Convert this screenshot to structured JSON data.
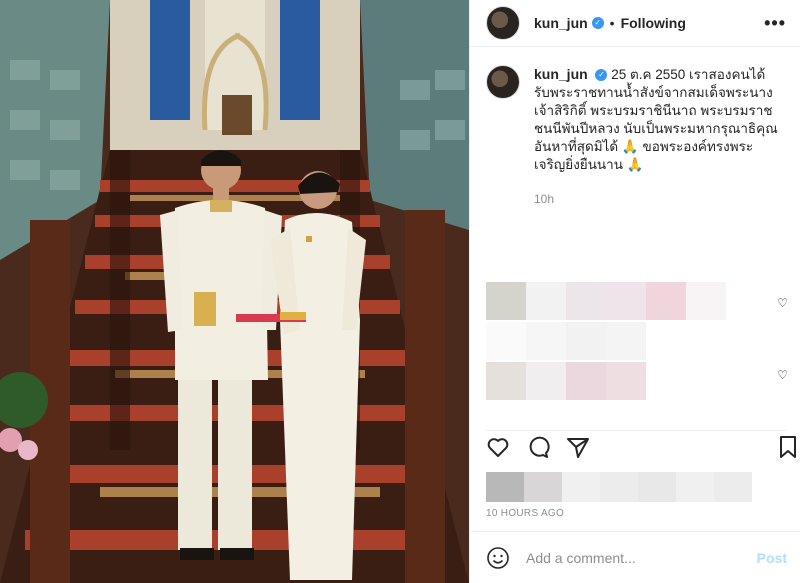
{
  "header": {
    "username": "kun_jun",
    "separator": "•",
    "follow_label": "Following",
    "more_label": "•••"
  },
  "caption": {
    "username": "kun_jun",
    "text": "25 ต.ค 2550 เราสองคนได้รับพระราชทานน้ำสังข์จากสมเด็จพระนางเจ้าสิริกิติ์ พระบรมราชินีนาถ พระบรมราชชนนีพันปีหลวง นับเป็นพระมหากรุณาธิคุณอันหาที่สุดมิได้ 🙏 ขอพระองค์ทรงพระเจริญยิ่งยืนนาน 🙏",
    "time": "10h"
  },
  "footer": {
    "posted_ago": "10 HOURS AGO",
    "comment_placeholder": "Add a comment...",
    "post_label": "Post"
  }
}
